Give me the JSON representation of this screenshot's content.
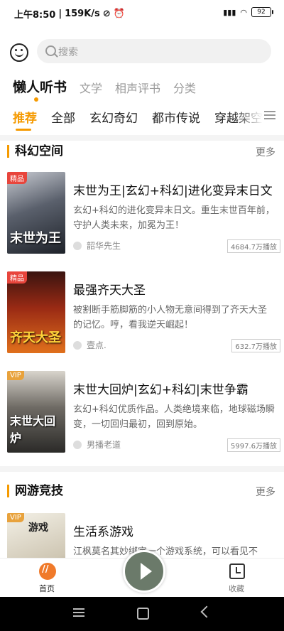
{
  "status_bar": {
    "time": "上午8:50",
    "speed": "159K/s",
    "battery": "92"
  },
  "header": {
    "search_placeholder": "搜索"
  },
  "top_tabs": [
    {
      "label": "懒人听书",
      "active": true
    },
    {
      "label": "文学",
      "active": false
    },
    {
      "label": "相声评书",
      "active": false
    },
    {
      "label": "分类",
      "active": false
    }
  ],
  "category_tabs": [
    {
      "label": "推荐",
      "active": true
    },
    {
      "label": "全部",
      "active": false
    },
    {
      "label": "玄幻奇幻",
      "active": false
    },
    {
      "label": "都市传说",
      "active": false
    },
    {
      "label": "穿越架空",
      "active": false
    }
  ],
  "sections": [
    {
      "title": "科幻空间",
      "more": "更多",
      "books": [
        {
          "badge": "精品",
          "cover_text": "末世为王",
          "title": "末世为王|玄幻+科幻|进化变异末日文",
          "description": "玄幻+科幻的进化变异末日文。重生末世百年前，守护人类未来，加冕为王！",
          "author": "韶华先生",
          "plays": "4684.7万播放"
        },
        {
          "badge": "精品",
          "cover_text": "齐天大圣",
          "title": "最强齐天大圣",
          "description": "被割断手筋脚筋的小人物无意间得到了齐天大圣的记忆。哼，看我逆天崛起！",
          "author": "壹点.",
          "plays": "632.7万播放"
        },
        {
          "badge": "VIP",
          "cover_text": "末世大回炉",
          "title": "末世大回炉|玄幻+科幻|末世争霸",
          "description": "玄幻+科幻优质作品。人类绝境来临，地球磁场瞬变，一切回归最初，回到原始。",
          "author": "男播老道",
          "plays": "5997.6万播放"
        }
      ]
    },
    {
      "title": "网游竞技",
      "more": "更多",
      "books": [
        {
          "badge": "VIP",
          "cover_text": "游戏",
          "title": "生活系游戏",
          "description": "江枫莫名其妙绑定一个游戏系统，可以看见不",
          "author": "",
          "plays": ""
        }
      ]
    }
  ],
  "bottom_nav": {
    "home_label": "首页",
    "favorites_label": "收藏"
  },
  "colors": {
    "accent": "#f59a00",
    "badge_red": "#e8453c",
    "badge_vip": "#e8a23c"
  }
}
